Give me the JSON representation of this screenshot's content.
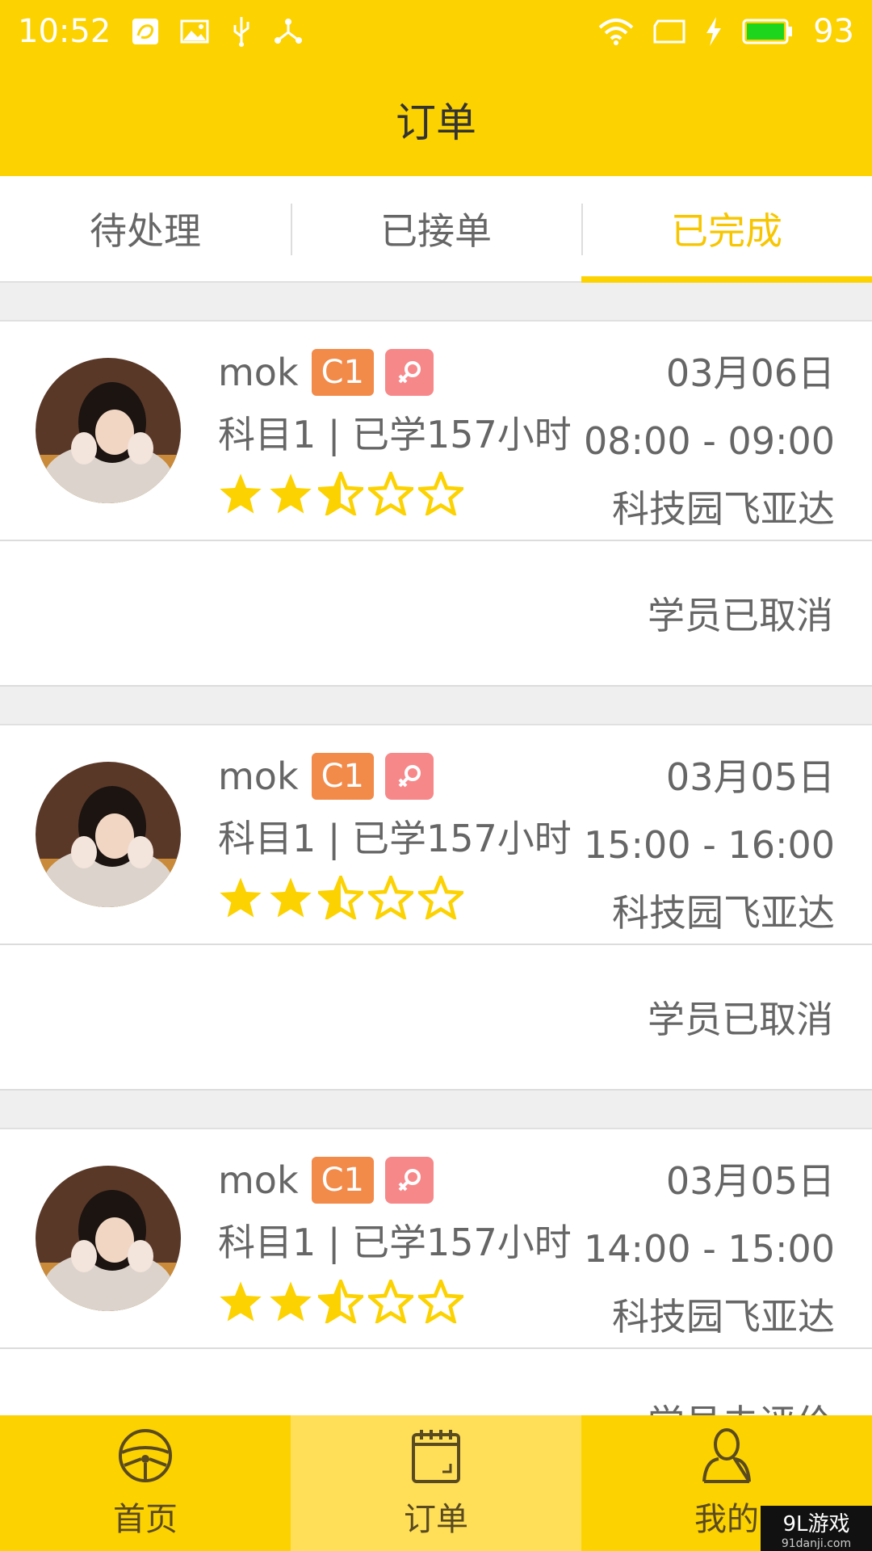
{
  "status_bar": {
    "time": "10:52",
    "battery": "93",
    "icons": [
      "uc-browser-icon",
      "image-icon",
      "usb-icon",
      "share-icon",
      "wifi-icon",
      "sim-icon",
      "charging-icon",
      "battery-icon"
    ]
  },
  "header": {
    "title": "订单"
  },
  "tabs": [
    {
      "label": "待处理",
      "active": false
    },
    {
      "label": "已接单",
      "active": false
    },
    {
      "label": "已完成",
      "active": true
    }
  ],
  "orders": [
    {
      "name": "mok",
      "license": "C1",
      "gender": "female",
      "course_info": "科目1 | 已学157小时",
      "rating": 2.5,
      "date": "03月06日",
      "time_range": "08:00 - 09:00",
      "location": "科技园飞亚达",
      "status": "学员已取消"
    },
    {
      "name": "mok",
      "license": "C1",
      "gender": "female",
      "course_info": "科目1 | 已学157小时",
      "rating": 2.5,
      "date": "03月05日",
      "time_range": "15:00 - 16:00",
      "location": "科技园飞亚达",
      "status": "学员已取消"
    },
    {
      "name": "mok",
      "license": "C1",
      "gender": "female",
      "course_info": "科目1 | 已学157小时",
      "rating": 2.5,
      "date": "03月05日",
      "time_range": "14:00 - 15:00",
      "location": "科技园飞亚达",
      "status": "学员未评价"
    }
  ],
  "bottom_nav": [
    {
      "label": "首页",
      "icon": "steering-wheel-icon",
      "active": false
    },
    {
      "label": "订单",
      "icon": "calendar-icon",
      "active": true
    },
    {
      "label": "我的",
      "icon": "person-icon",
      "active": false
    }
  ],
  "watermark": {
    "text": "9L游戏",
    "sub": "91danji.com"
  },
  "colors": {
    "brand_yellow": "#fcd200",
    "tab_active": "#f7c600",
    "badge_c1": "#f28a4a",
    "badge_gender": "#f7888a",
    "star": "#fcd200"
  }
}
